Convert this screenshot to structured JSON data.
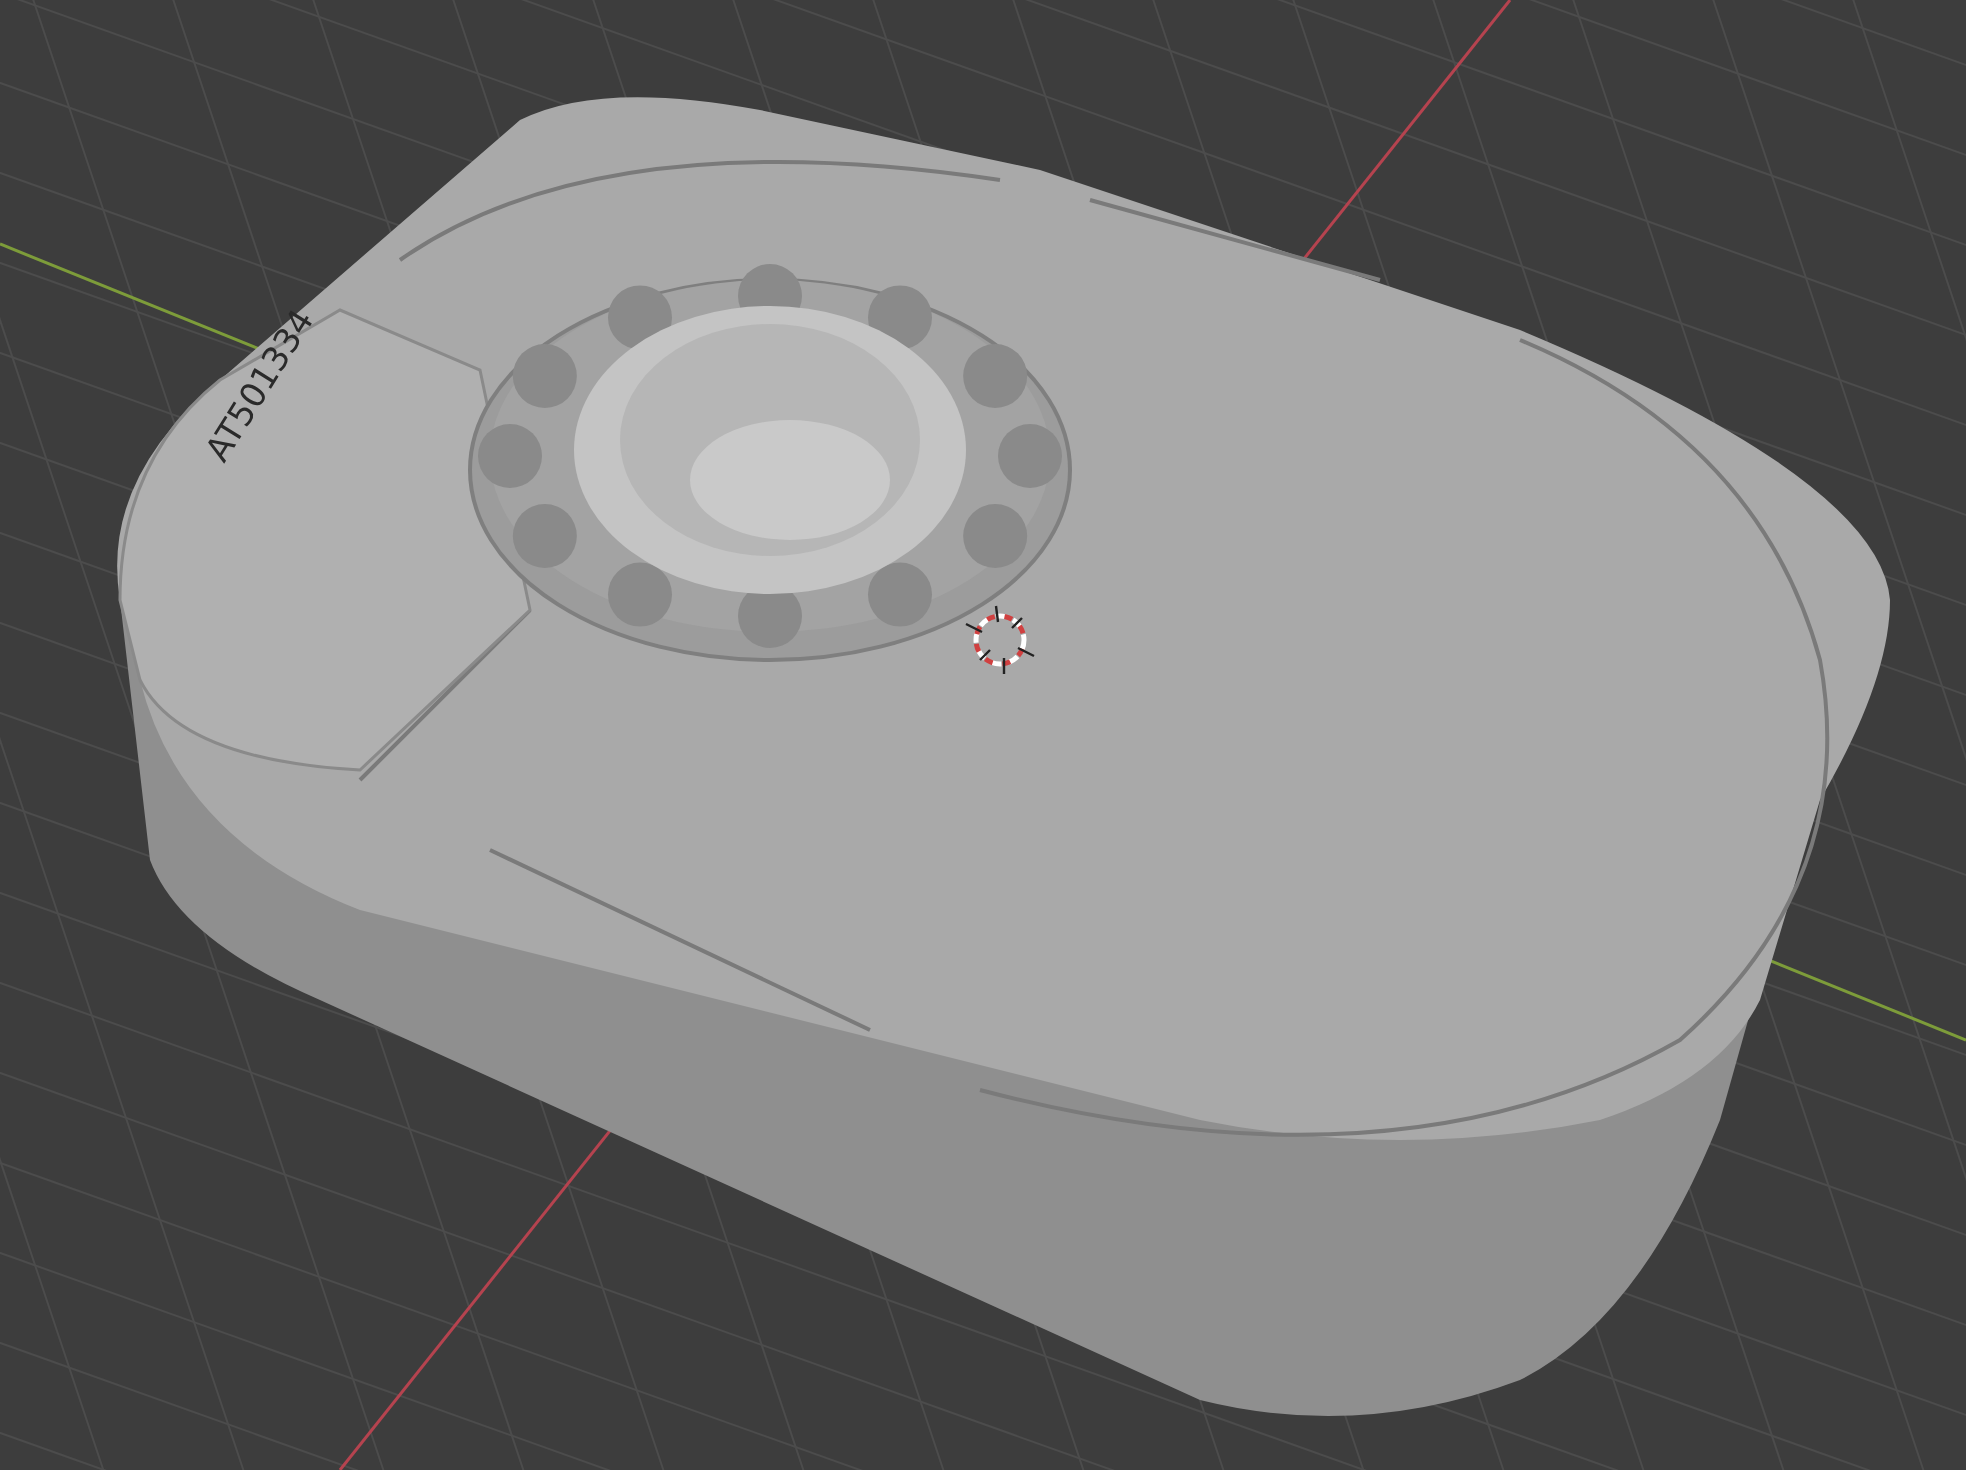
{
  "viewport": {
    "model_label": "AT501334"
  }
}
